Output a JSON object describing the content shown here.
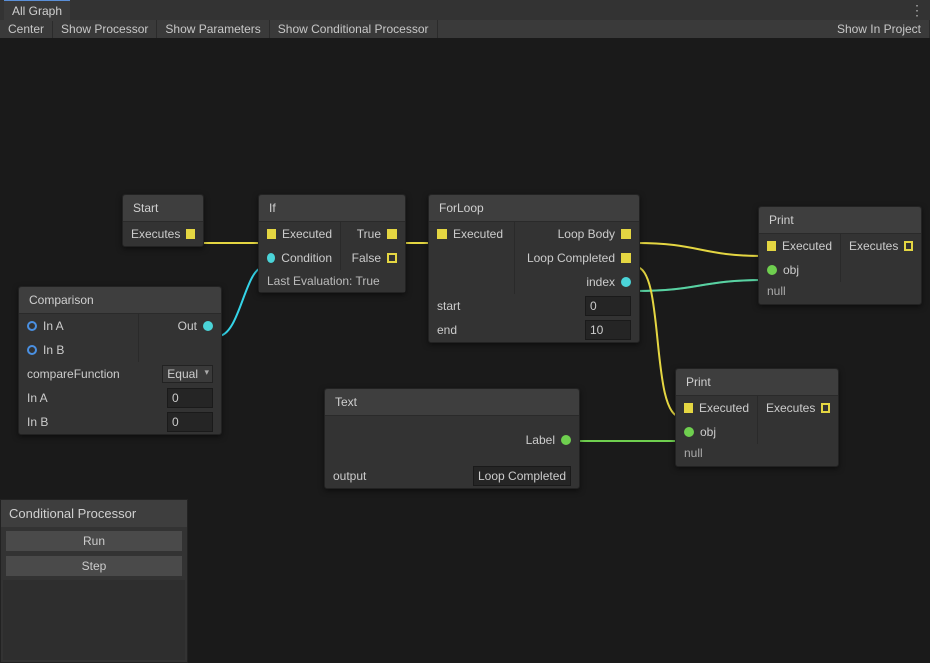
{
  "titlebar": {
    "tab": "All Graph"
  },
  "toolbar": {
    "center": "Center",
    "show_processor": "Show Processor",
    "show_parameters": "Show Parameters",
    "show_conditional": "Show Conditional Processor",
    "show_in_project": "Show In Project"
  },
  "nodes": {
    "start": {
      "title": "Start",
      "executes": "Executes"
    },
    "if": {
      "title": "If",
      "executed": "Executed",
      "condition": "Condition",
      "true": "True",
      "false": "False",
      "last_eval": "Last Evaluation: True"
    },
    "comparison": {
      "title": "Comparison",
      "in_a": "In A",
      "in_b": "In B",
      "out": "Out",
      "compare_fn_label": "compareFunction",
      "compare_fn_value": "Equal",
      "in_a_field": "In A",
      "in_a_value": "0",
      "in_b_field": "In B",
      "in_b_value": "0"
    },
    "forloop": {
      "title": "ForLoop",
      "executed": "Executed",
      "loop_body": "Loop Body",
      "loop_completed": "Loop Completed",
      "index": "index",
      "start_label": "start",
      "start_value": "0",
      "end_label": "end",
      "end_value": "10"
    },
    "text": {
      "title": "Text",
      "label": "Label",
      "output_label": "output",
      "output_value": "Loop Completed"
    },
    "print1": {
      "title": "Print",
      "executed": "Executed",
      "obj": "obj",
      "executes": "Executes",
      "null": "null"
    },
    "print2": {
      "title": "Print",
      "executed": "Executed",
      "obj": "obj",
      "executes": "Executes",
      "null": "null"
    }
  },
  "panel": {
    "title": "Conditional Processor",
    "run": "Run",
    "step": "Step"
  }
}
